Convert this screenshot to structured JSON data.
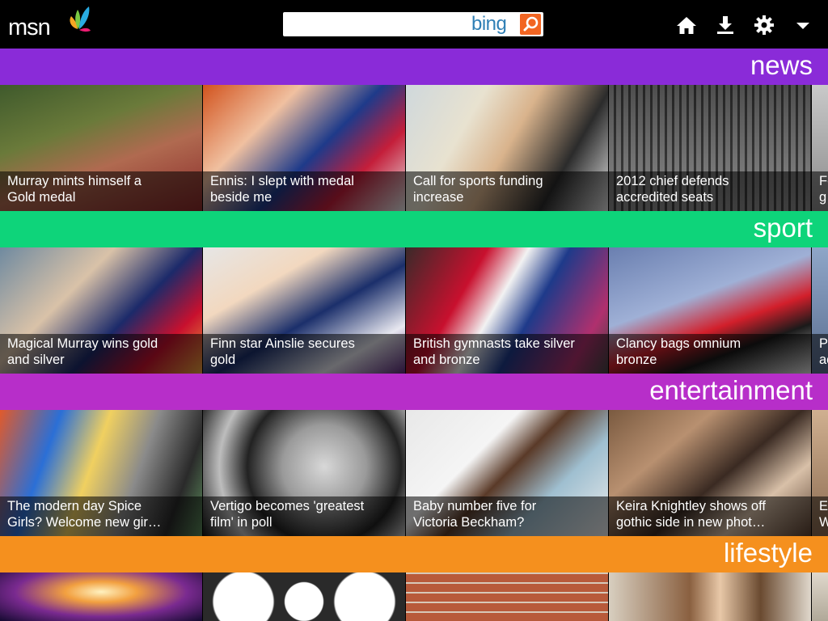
{
  "header": {
    "logo_text": "msn",
    "search": {
      "placeholder": "",
      "brand": "bing"
    },
    "icons": [
      "home-icon",
      "download-icon",
      "settings-gear-icon",
      "menu-chevron-down-icon"
    ]
  },
  "colors": {
    "news": "#8a2bd8",
    "sport": "#0ed47a",
    "entertainment": "#b72ec9",
    "lifestyle": "#f5901e",
    "bing_blue": "#2f7fb5",
    "bing_orange": "#f26522"
  },
  "sections": [
    {
      "title": "news",
      "tiles": [
        "Murray mints himself a\nGold medal",
        "Ennis: I slept with medal\nbeside me",
        "Call for sports funding\nincrease",
        "2012 chief defends\naccredited seats",
        "Fe\ng"
      ]
    },
    {
      "title": "sport",
      "tiles": [
        "Magical Murray wins gold\nand silver",
        "Finn star Ainslie secures\ngold",
        "British gymnasts take silver\nand bronze",
        "Clancy bags omnium\nbronze",
        "P\nac"
      ]
    },
    {
      "title": "entertainment",
      "tiles": [
        "The modern day Spice\nGirls? Welcome new gir…",
        "Vertigo becomes 'greatest\nfilm' in poll",
        "Baby number five for\nVictoria Beckham?",
        "Keira Knightley shows off\ngothic side in new phot…",
        "E\nW"
      ]
    },
    {
      "title": "lifestyle",
      "tiles": [
        "",
        "",
        "",
        "",
        ""
      ]
    }
  ]
}
